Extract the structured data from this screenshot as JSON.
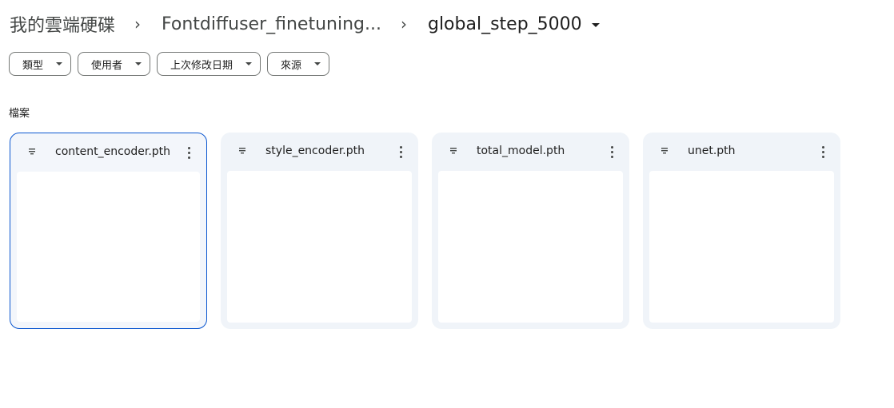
{
  "breadcrumb": {
    "root": "我的雲端硬碟",
    "parent": "Fontdiffuser_finetuning...",
    "current": "global_step_5000"
  },
  "filters": [
    {
      "label": "類型"
    },
    {
      "label": "使用者"
    },
    {
      "label": "上次修改日期"
    },
    {
      "label": "來源"
    }
  ],
  "section": {
    "label": "檔案"
  },
  "files": [
    {
      "name": "content_encoder.pth",
      "selected": true
    },
    {
      "name": "style_encoder.pth",
      "selected": false
    },
    {
      "name": "total_model.pth",
      "selected": false
    },
    {
      "name": "unet.pth",
      "selected": false
    }
  ],
  "icons": {
    "file": "file-lines-icon",
    "more": "more-vert-icon",
    "caret": "caret-down-icon",
    "separator": "chevron-right-icon"
  },
  "colors": {
    "selected_border": "#0b57d0",
    "card_bg": "#f0f4f9"
  }
}
